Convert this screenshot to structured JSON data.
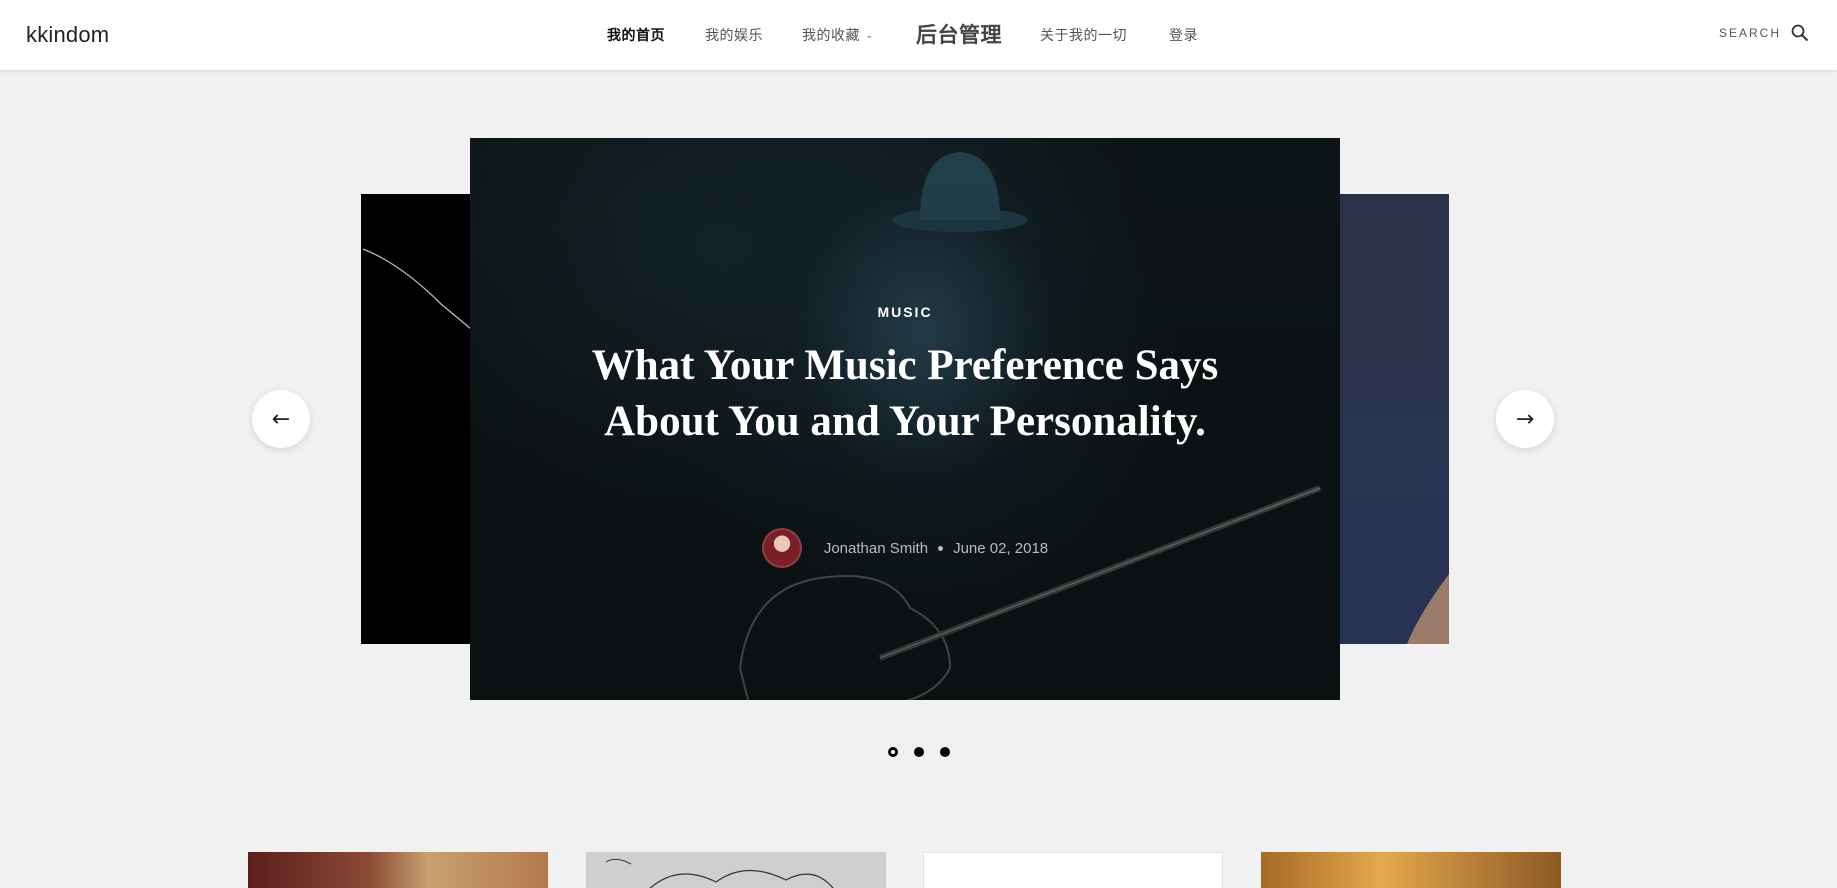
{
  "header": {
    "logo": "kkindom",
    "nav": [
      {
        "label": "我的首页",
        "active": true
      },
      {
        "label": "我的娱乐"
      },
      {
        "label": "我的收藏",
        "has_dropdown": true
      },
      {
        "label": "后台管理",
        "emphasis": true
      },
      {
        "label": "关于我的一切"
      },
      {
        "label": "登录"
      }
    ],
    "search_label": "SEARCH",
    "search_icon": "search-icon"
  },
  "slider": {
    "category": "MUSIC",
    "title": "What Your Music Preference Says About You and Your Personality.",
    "author": "Jonathan Smith",
    "date": "June 02, 2018",
    "prev_arrow": "←",
    "next_arrow": "→",
    "dots_count": 3,
    "active_dot": 0
  },
  "colors": {
    "header_bg": "#ffffff",
    "page_bg": "#f1f1f1",
    "slide_text": "#ffffff"
  }
}
